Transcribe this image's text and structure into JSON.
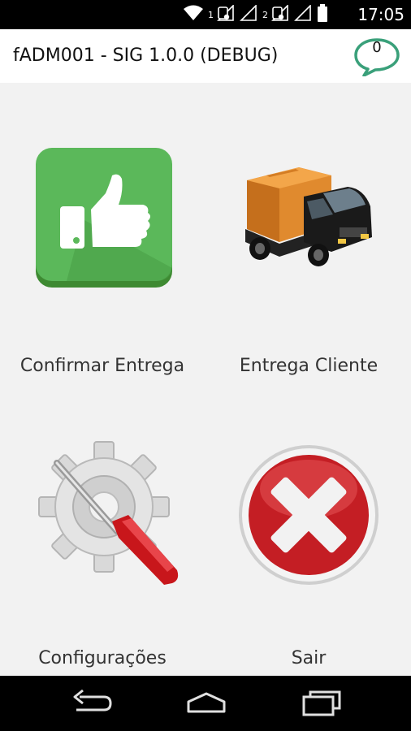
{
  "status_bar": {
    "sim1_label": "1",
    "sim2_label": "2",
    "time": "17:05",
    "icons": [
      "wifi-icon",
      "sim1-signal-icon",
      "sim2-signal-icon",
      "battery-icon"
    ]
  },
  "app_bar": {
    "title": "fADM001 - SIG 1.0.0 (DEBUG)",
    "notification_count": "0",
    "accent_color": "#3aa07a"
  },
  "menu": {
    "items": [
      {
        "label": "Confirmar Entrega",
        "icon": "thumbs-up-icon"
      },
      {
        "label": "Entrega Cliente",
        "icon": "delivery-truck-icon"
      },
      {
        "label": "Configurações",
        "icon": "settings-gear-icon"
      },
      {
        "label": "Sair",
        "icon": "exit-icon"
      }
    ]
  },
  "nav_bar": {
    "icons": [
      "back-icon",
      "home-icon",
      "recent-apps-icon"
    ]
  }
}
